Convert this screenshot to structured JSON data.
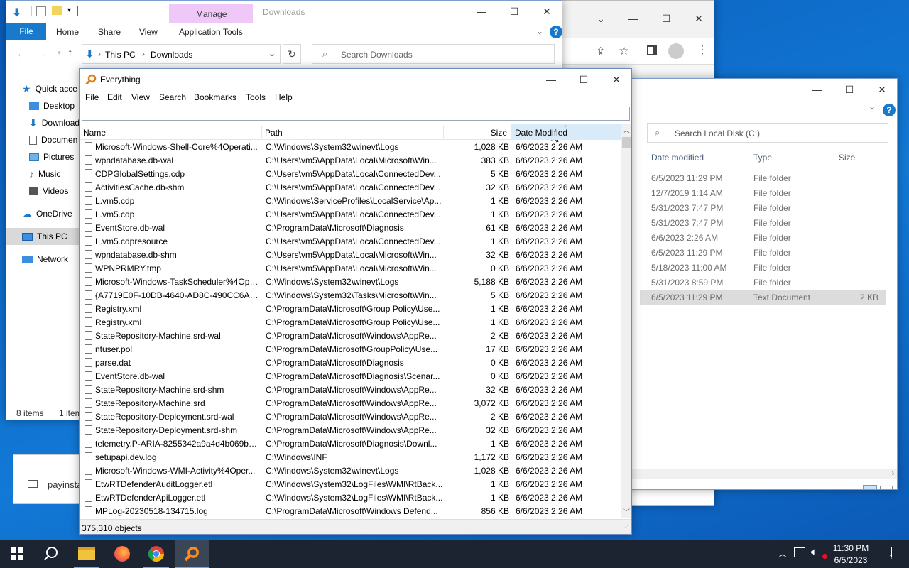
{
  "chrome": {
    "toolbar": {}
  },
  "explorer_c": {
    "search_placeholder": "Search Local Disk (C:)",
    "columns": {
      "date": "Date modified",
      "type": "Type",
      "size": "Size"
    },
    "rows": [
      {
        "date": "6/5/2023 11:29 PM",
        "type": "File folder",
        "size": ""
      },
      {
        "date": "12/7/2019 1:14 AM",
        "type": "File folder",
        "size": ""
      },
      {
        "date": "5/31/2023 7:47 PM",
        "type": "File folder",
        "size": ""
      },
      {
        "date": "5/31/2023 7:47 PM",
        "type": "File folder",
        "size": ""
      },
      {
        "date": "6/6/2023 2:26 AM",
        "type": "File folder",
        "size": ""
      },
      {
        "date": "6/5/2023 11:29 PM",
        "type": "File folder",
        "size": ""
      },
      {
        "date": "5/18/2023 11:00 AM",
        "type": "File folder",
        "size": ""
      },
      {
        "date": "5/31/2023 8:59 PM",
        "type": "File folder",
        "size": ""
      },
      {
        "date": "6/5/2023 11:29 PM",
        "type": "Text Document",
        "size": "2 KB"
      }
    ]
  },
  "explorer_dl": {
    "title": "Downloads",
    "manage": "Manage",
    "tabs": {
      "file": "File",
      "home": "Home",
      "share": "Share",
      "view": "View",
      "app_tools": "Application Tools"
    },
    "breadcrumb": {
      "root": "This PC",
      "sep": "›",
      "current": "Downloads"
    },
    "search_placeholder": "Search Downloads",
    "nav": {
      "quick_access": "Quick acce",
      "desktop": "Desktop",
      "downloads": "Download",
      "documents": "Documen",
      "pictures": "Pictures",
      "music": "Music",
      "videos": "Videos",
      "onedrive": "OneDrive",
      "this_pc": "This PC",
      "network": "Network"
    },
    "status_items": "8 items",
    "status_sel": "1 item",
    "partial_file": "payinsta"
  },
  "everything": {
    "title": "Everything",
    "menu": [
      "File",
      "Edit",
      "View",
      "Search",
      "Bookmarks",
      "Tools",
      "Help"
    ],
    "search_value": "",
    "columns": {
      "name": "Name",
      "path": "Path",
      "size": "Size",
      "date": "Date Modified"
    },
    "status": "375,310 objects",
    "rows": [
      {
        "name": "Microsoft-Windows-Shell-Core%4Operati...",
        "path": "C:\\Windows\\System32\\winevt\\Logs",
        "size": "1,028 KB",
        "date": "6/6/2023 2:26 AM"
      },
      {
        "name": "wpndatabase.db-wal",
        "path": "C:\\Users\\vm5\\AppData\\Local\\Microsoft\\Win...",
        "size": "383 KB",
        "date": "6/6/2023 2:26 AM"
      },
      {
        "name": "CDPGlobalSettings.cdp",
        "path": "C:\\Users\\vm5\\AppData\\Local\\ConnectedDev...",
        "size": "5 KB",
        "date": "6/6/2023 2:26 AM"
      },
      {
        "name": "ActivitiesCache.db-shm",
        "path": "C:\\Users\\vm5\\AppData\\Local\\ConnectedDev...",
        "size": "32 KB",
        "date": "6/6/2023 2:26 AM"
      },
      {
        "name": "L.vm5.cdp",
        "path": "C:\\Windows\\ServiceProfiles\\LocalService\\Ap...",
        "size": "1 KB",
        "date": "6/6/2023 2:26 AM"
      },
      {
        "name": "L.vm5.cdp",
        "path": "C:\\Users\\vm5\\AppData\\Local\\ConnectedDev...",
        "size": "1 KB",
        "date": "6/6/2023 2:26 AM"
      },
      {
        "name": "EventStore.db-wal",
        "path": "C:\\ProgramData\\Microsoft\\Diagnosis",
        "size": "61 KB",
        "date": "6/6/2023 2:26 AM"
      },
      {
        "name": "L.vm5.cdpresource",
        "path": "C:\\Users\\vm5\\AppData\\Local\\ConnectedDev...",
        "size": "1 KB",
        "date": "6/6/2023 2:26 AM"
      },
      {
        "name": "wpndatabase.db-shm",
        "path": "C:\\Users\\vm5\\AppData\\Local\\Microsoft\\Win...",
        "size": "32 KB",
        "date": "6/6/2023 2:26 AM"
      },
      {
        "name": "WPNPRMRY.tmp",
        "path": "C:\\Users\\vm5\\AppData\\Local\\Microsoft\\Win...",
        "size": "0 KB",
        "date": "6/6/2023 2:26 AM"
      },
      {
        "name": "Microsoft-Windows-TaskScheduler%4Ope...",
        "path": "C:\\Windows\\System32\\winevt\\Logs",
        "size": "5,188 KB",
        "date": "6/6/2023 2:26 AM"
      },
      {
        "name": "{A7719E0F-10DB-4640-AD8C-490CC6AD52...",
        "path": "C:\\Windows\\System32\\Tasks\\Microsoft\\Win...",
        "size": "5 KB",
        "date": "6/6/2023 2:26 AM"
      },
      {
        "name": "Registry.xml",
        "path": "C:\\ProgramData\\Microsoft\\Group Policy\\Use...",
        "size": "1 KB",
        "date": "6/6/2023 2:26 AM"
      },
      {
        "name": "Registry.xml",
        "path": "C:\\ProgramData\\Microsoft\\Group Policy\\Use...",
        "size": "1 KB",
        "date": "6/6/2023 2:26 AM"
      },
      {
        "name": "StateRepository-Machine.srd-wal",
        "path": "C:\\ProgramData\\Microsoft\\Windows\\AppRe...",
        "size": "2 KB",
        "date": "6/6/2023 2:26 AM"
      },
      {
        "name": "ntuser.pol",
        "path": "C:\\ProgramData\\Microsoft\\GroupPolicy\\Use...",
        "size": "17 KB",
        "date": "6/6/2023 2:26 AM"
      },
      {
        "name": "parse.dat",
        "path": "C:\\ProgramData\\Microsoft\\Diagnosis",
        "size": "0 KB",
        "date": "6/6/2023 2:26 AM"
      },
      {
        "name": "EventStore.db-wal",
        "path": "C:\\ProgramData\\Microsoft\\Diagnosis\\Scenar...",
        "size": "0 KB",
        "date": "6/6/2023 2:26 AM"
      },
      {
        "name": "StateRepository-Machine.srd-shm",
        "path": "C:\\ProgramData\\Microsoft\\Windows\\AppRe...",
        "size": "32 KB",
        "date": "6/6/2023 2:26 AM"
      },
      {
        "name": "StateRepository-Machine.srd",
        "path": "C:\\ProgramData\\Microsoft\\Windows\\AppRe...",
        "size": "3,072 KB",
        "date": "6/6/2023 2:26 AM"
      },
      {
        "name": "StateRepository-Deployment.srd-wal",
        "path": "C:\\ProgramData\\Microsoft\\Windows\\AppRe...",
        "size": "2 KB",
        "date": "6/6/2023 2:26 AM"
      },
      {
        "name": "StateRepository-Deployment.srd-shm",
        "path": "C:\\ProgramData\\Microsoft\\Windows\\AppRe...",
        "size": "32 KB",
        "date": "6/6/2023 2:26 AM"
      },
      {
        "name": "telemetry.P-ARIA-8255342a9a4d4b069b7a...",
        "path": "C:\\ProgramData\\Microsoft\\Diagnosis\\Downl...",
        "size": "1 KB",
        "date": "6/6/2023 2:26 AM"
      },
      {
        "name": "setupapi.dev.log",
        "path": "C:\\Windows\\INF",
        "size": "1,172 KB",
        "date": "6/6/2023 2:26 AM"
      },
      {
        "name": "Microsoft-Windows-WMI-Activity%4Oper...",
        "path": "C:\\Windows\\System32\\winevt\\Logs",
        "size": "1,028 KB",
        "date": "6/6/2023 2:26 AM"
      },
      {
        "name": "EtwRTDefenderAuditLogger.etl",
        "path": "C:\\Windows\\System32\\LogFiles\\WMI\\RtBack...",
        "size": "1 KB",
        "date": "6/6/2023 2:26 AM"
      },
      {
        "name": "EtwRTDefenderApiLogger.etl",
        "path": "C:\\Windows\\System32\\LogFiles\\WMI\\RtBack...",
        "size": "1 KB",
        "date": "6/6/2023 2:26 AM"
      },
      {
        "name": "MPLog-20230518-134715.log",
        "path": "C:\\ProgramData\\Microsoft\\Windows Defend...",
        "size": "856 KB",
        "date": "6/6/2023 2:26 AM"
      }
    ]
  },
  "taskbar": {
    "time": "11:30 PM",
    "date": "6/5/2023",
    "notif_count": "1"
  },
  "colors": {
    "accent": "#1979ca",
    "manage_bg": "#f0c8f7",
    "taskbar": "#1c2431"
  }
}
